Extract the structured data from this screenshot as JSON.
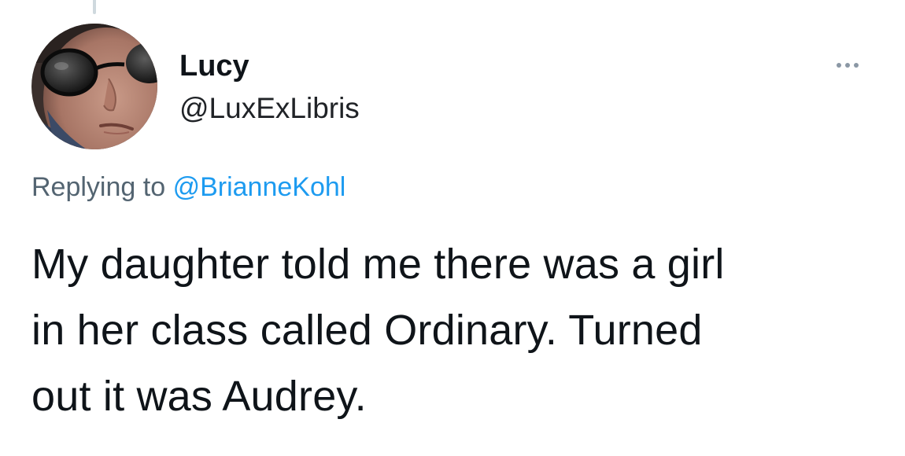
{
  "tweet": {
    "author": {
      "display_name": "Lucy",
      "handle": "@LuxExLibris",
      "avatar_icon": "profile-photo"
    },
    "more_icon": "more-horizontal-icon",
    "reply_context": {
      "prefix": "Replying to",
      "mention": "@BrianneKohl"
    },
    "text_lines": [
      "My daughter told me there was a girl",
      "in her class called Ordinary. Turned",
      "out it was Audrey."
    ]
  },
  "colors": {
    "text_primary": "#0f1419",
    "text_secondary": "#536471",
    "link": "#1d9bf0",
    "icon_gray": "#8b98a5"
  }
}
